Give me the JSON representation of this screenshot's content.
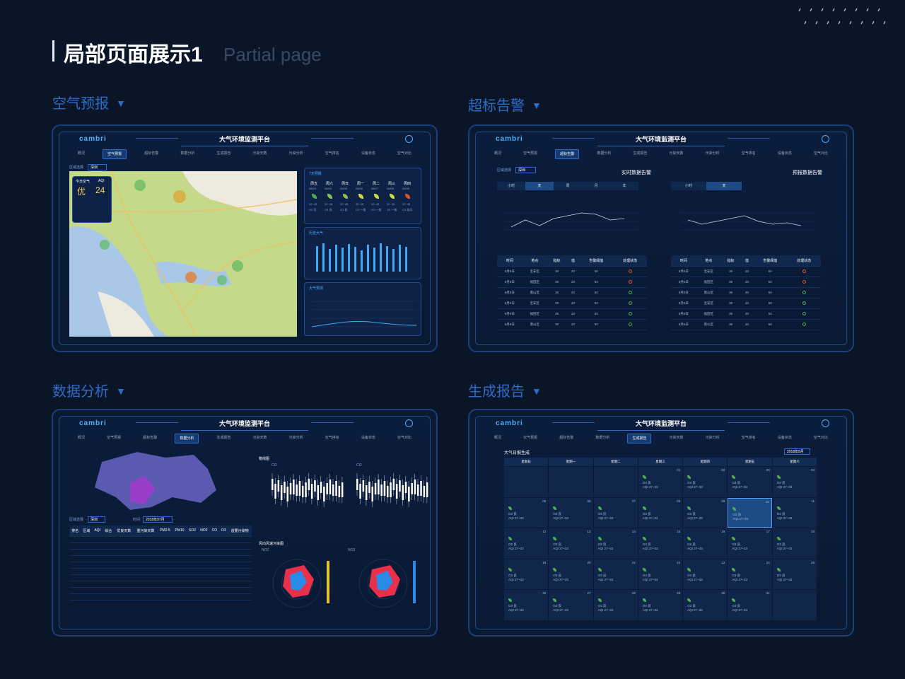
{
  "header": {
    "title": "局部页面展示1",
    "subtitle": "Partial page"
  },
  "sections": {
    "air": {
      "label": "空气预报",
      "arrow": "▼"
    },
    "alarm": {
      "label": "超标告警",
      "arrow": "▼"
    },
    "analysis": {
      "label": "数据分析",
      "arrow": "▼"
    },
    "report": {
      "label": "生成报告",
      "arrow": "▼"
    }
  },
  "app": {
    "logo": "cambri",
    "title": "大气环境监测平台"
  },
  "nav": [
    "概况",
    "空气预报",
    "超标告警",
    "数据分析",
    "生成报告",
    "污染天数",
    "污染分析",
    "空气排名",
    "设备状态",
    "空气对比"
  ],
  "air_panel": {
    "region_label": "区域选择",
    "region_value": "深圳",
    "today_label": "今日空气",
    "aqi_label": "AQI",
    "quality": "优",
    "aqi": "24",
    "forecast_title": "7天预报",
    "history_title": "历史大气",
    "forecast2_title": "大气预测",
    "days": [
      "周五",
      "周六",
      "周日",
      "周一",
      "周二",
      "周三",
      "周四"
    ],
    "dates": [
      "08/03",
      "08/04",
      "08/05",
      "08/06",
      "08/07",
      "08/08",
      "08/09"
    ],
    "day_ranges": [
      "32~45",
      "32~45",
      "32~45",
      "32~45",
      "32~45",
      "32~45",
      "32~45"
    ],
    "day_levels": [
      "O3 优",
      "O3 良",
      "O3 良",
      "O3 一般",
      "O3 一般",
      "O3 一般",
      "O3 差远"
    ]
  },
  "alarm_panel": {
    "region_label": "区域选择",
    "region_value": "深圳",
    "realtime_title": "实时数据告警",
    "forecast_title": "预报数据告警",
    "tabs_left": [
      "小时",
      "天",
      "周",
      "月",
      "年"
    ],
    "tabs_right": [
      "小时",
      "天"
    ],
    "columns": [
      "时间",
      "地点",
      "指标",
      "值",
      "告警阈值",
      "处理状态"
    ],
    "rows_left": [
      [
        "8月8日",
        "宝安区",
        "39",
        "20",
        "50"
      ],
      [
        "8月8日",
        "福田区",
        "39",
        "20",
        "50"
      ],
      [
        "8月8日",
        "南山区",
        "39",
        "20",
        "50"
      ],
      [
        "8月8日",
        "宝安区",
        "39",
        "20",
        "50"
      ],
      [
        "8月8日",
        "福田区",
        "39",
        "20",
        "50"
      ],
      [
        "8月8日",
        "南山区",
        "39",
        "20",
        "50"
      ]
    ],
    "rows_right": [
      [
        "8月8日",
        "宝安区",
        "39",
        "20",
        "50"
      ],
      [
        "8月8日",
        "福田区",
        "39",
        "20",
        "50"
      ],
      [
        "8月8日",
        "南山区",
        "39",
        "20",
        "50"
      ],
      [
        "8月8日",
        "宝安区",
        "39",
        "20",
        "50"
      ],
      [
        "8月8日",
        "福田区",
        "39",
        "20",
        "50"
      ],
      [
        "8月8日",
        "南山区",
        "39",
        "20",
        "50"
      ]
    ]
  },
  "analysis_panel": {
    "box_title": "箱线图",
    "rose_title": "风向风速污染图",
    "region_label": "区域选择",
    "region_value": "深圳",
    "time_label": "时间",
    "time_value": "2018年07月",
    "pollutant_a": "CO",
    "pollutant_b": "NO2",
    "columns": [
      "排名",
      "区域",
      "AQI",
      "综合",
      "优良天数",
      "重污染天数",
      "PM2.5",
      "PM10",
      "SO2",
      "NO2",
      "CO",
      "O3",
      "首要污染物"
    ]
  },
  "report_panel": {
    "title": "大气日报生成",
    "month": "2018年8月",
    "weekdays": [
      "星期日",
      "星期一",
      "星期二",
      "星期三",
      "星期四",
      "星期五",
      "星期六"
    ],
    "cell_level": "O3 良",
    "cell_aqi": "AQI 27~33"
  }
}
